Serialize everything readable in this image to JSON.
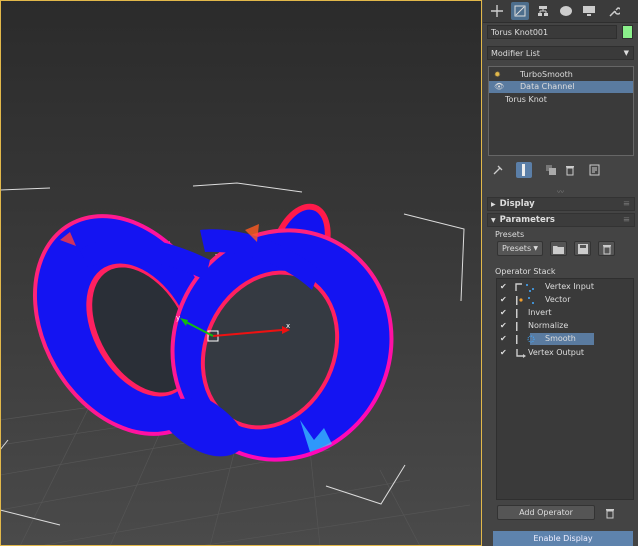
{
  "viewport": {
    "name": "Perspective viewport",
    "torus_color": "#1010f0",
    "border_color": "#e2b84a"
  },
  "command_panel": {
    "tabs": [
      {
        "icon": "plus-icon"
      },
      {
        "icon": "modify-icon"
      },
      {
        "icon": "hierarchy-icon"
      },
      {
        "icon": "motion-icon"
      },
      {
        "icon": "display-icon"
      },
      {
        "icon": "utilities-wrench-icon"
      }
    ],
    "object_name": "Torus Knot001",
    "object_color": "#8bf08b",
    "modifier_list_label": "Modifier List",
    "modifier_stack": [
      {
        "label": "TurboSmooth",
        "icon": "lightbulb-icon"
      },
      {
        "label": "Data Channel",
        "icon": "eye-icon",
        "selected": true
      },
      {
        "label": "Torus Knot"
      }
    ],
    "rollups": {
      "display": "Display",
      "parameters": "Parameters"
    },
    "presets_label": "Presets",
    "presets_button": "Presets",
    "operator_stack_label": "Operator Stack",
    "operators": [
      {
        "label": "Vertex Input"
      },
      {
        "label": "Vector"
      },
      {
        "label": "Invert"
      },
      {
        "label": "Normalize"
      },
      {
        "label": "Smooth",
        "selected": true
      },
      {
        "label": "Vertex Output"
      }
    ],
    "add_operator": "Add Operator",
    "enable_display": "Enable Display"
  }
}
